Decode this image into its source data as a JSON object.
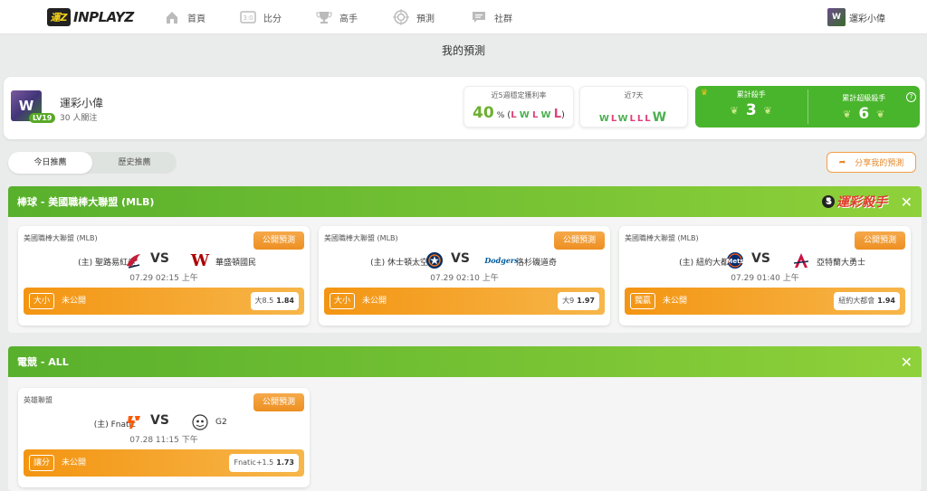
{
  "nav": {
    "logo_badge": "運Z",
    "logo_text": "INPLAYZ",
    "items": [
      {
        "label": "首頁",
        "icon": "home-icon"
      },
      {
        "label": "比分",
        "icon": "scoreboard-icon"
      },
      {
        "label": "高手",
        "icon": "trophy-icon"
      },
      {
        "label": "預測",
        "icon": "target-icon"
      },
      {
        "label": "社群",
        "icon": "chat-icon"
      }
    ],
    "user_name": "運彩小偉"
  },
  "page_title": "我的預測",
  "profile": {
    "name": "運彩小偉",
    "level": "LV19",
    "followers": "30 人關注",
    "stats": {
      "win_rate_caption": "近5週穩定獲利率",
      "win_rate_value": "40",
      "win_rate_unit": "%",
      "win_rate_seq": [
        "L",
        "W",
        "L",
        "W",
        "L"
      ],
      "week_caption": "近7天",
      "week_seq": [
        "W",
        "L",
        "W",
        "L",
        "L",
        "L",
        "W"
      ]
    },
    "killer": {
      "caption": "累計殺手",
      "value": "3"
    },
    "super_killer": {
      "caption": "累計超級殺手",
      "value": "6"
    }
  },
  "tabs": {
    "today": "今日推薦",
    "history": "歷史推薦"
  },
  "share_label": "分享我的預測",
  "sections": [
    {
      "title": "棒球 - 美國職棒大聯盟 (MLB)",
      "brand": "運彩殺手",
      "cards": [
        {
          "league": "美國職棒大聯盟 (MLB)",
          "open_label": "公開預測",
          "home": "(主) 聖路易紅雀",
          "away": "華盛頓國民",
          "time": "07.29 02:15 上午",
          "bet_type": "大小",
          "status": "未公開",
          "odds_label": "大8.5",
          "odds_value": "1.84"
        },
        {
          "league": "美國職棒大聯盟 (MLB)",
          "open_label": "公開預測",
          "home": "(主) 休士頓太空人",
          "away": "洛杉磯道奇",
          "time": "07.29 02:10 上午",
          "bet_type": "大小",
          "status": "未公開",
          "odds_label": "大9",
          "odds_value": "1.97"
        },
        {
          "league": "美國職棒大聯盟 (MLB)",
          "open_label": "公開預測",
          "home": "(主) 紐約大都會",
          "away": "亞特蘭大勇士",
          "time": "07.29 01:40 上午",
          "bet_type": "獨贏",
          "status": "未公開",
          "odds_label": "紐約大都會",
          "odds_value": "1.94"
        }
      ]
    },
    {
      "title": "電競 - ALL",
      "cards": [
        {
          "league": "英雄聯盟",
          "open_label": "公開預測",
          "home": "(主) Fnatic",
          "away": "G2",
          "time": "07.28 11:15 下午",
          "bet_type": "讓分",
          "status": "未公開",
          "odds_label": "Fnatic+1.5",
          "odds_value": "1.73"
        }
      ]
    }
  ],
  "colors": {
    "accent_green": "#58b02c",
    "accent_orange": "#f39512",
    "win": "#4caf50",
    "loss": "#e0407a"
  }
}
